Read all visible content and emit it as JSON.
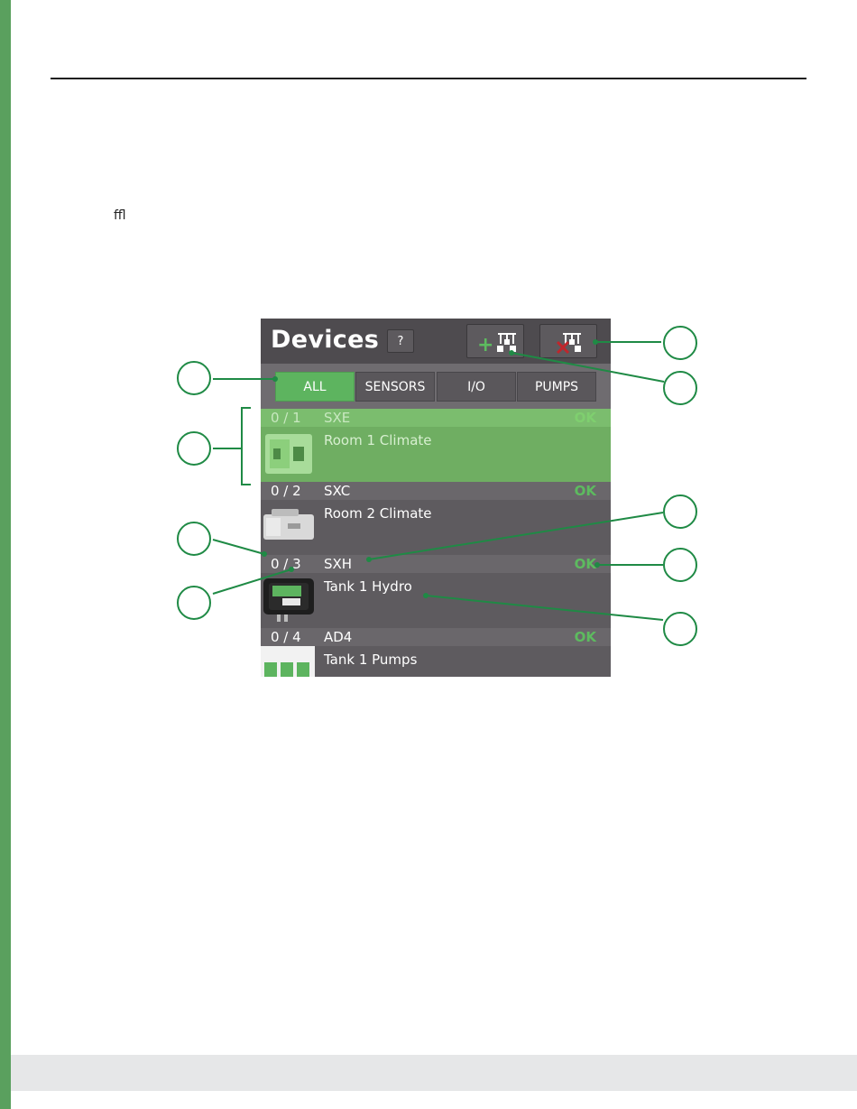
{
  "document": {
    "ligature_text": "ﬄ"
  },
  "app": {
    "title": "Devices",
    "help_label": "?",
    "add_network_icon": "add-network-icon",
    "remove_network_icon": "remove-network-icon"
  },
  "tabs": [
    {
      "label": "ALL",
      "active": true
    },
    {
      "label": "SENSORS",
      "active": false
    },
    {
      "label": "I/O",
      "active": false
    },
    {
      "label": "PUMPS",
      "active": false
    }
  ],
  "devices": [
    {
      "address": "0 / 1",
      "type": "SXE",
      "status": "OK",
      "name": "Room 1 Climate",
      "selected": true
    },
    {
      "address": "0 / 2",
      "type": "SXC",
      "status": "OK",
      "name": "Room 2 Climate",
      "selected": false
    },
    {
      "address": "0 / 3",
      "type": "SXH",
      "status": "OK",
      "name": "Tank 1 Hydro",
      "selected": false
    },
    {
      "address": "0 / 4",
      "type": "AD4",
      "status": "OK",
      "name": "Tank 1 Pumps",
      "selected": false
    }
  ],
  "colors": {
    "accent_green": "#5db45f",
    "panel_bg": "#5e5b5f",
    "callout_green": "#1f8a45",
    "sidebar_green": "#5aa05e"
  }
}
